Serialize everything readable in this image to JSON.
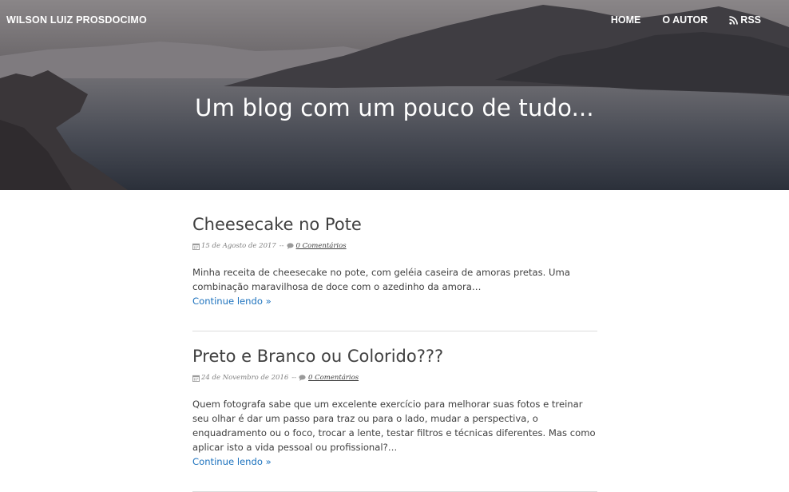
{
  "header": {
    "brand": "WILSON LUIZ PROSDOCIMO",
    "nav": [
      {
        "label": "HOME"
      },
      {
        "label": "O AUTOR"
      },
      {
        "label": "RSS",
        "icon": "rss-icon"
      }
    ],
    "tagline": "Um blog com um pouco de tudo..."
  },
  "posts": [
    {
      "title": "Cheesecake no Pote",
      "date": "15 de Agosto de 2017",
      "separator": "--",
      "comments": "0 Comentários",
      "excerpt": "Minha receita de cheesecake no pote, com geléia caseira de amoras pretas. Uma combinação maravilhosa de doce com o azedinho da amora…",
      "more": "Continue lendo »"
    },
    {
      "title": "Preto e Branco ou Colorido???",
      "date": "24 de Novembro de 2016",
      "separator": "--",
      "comments": "0 Comentários",
      "excerpt": "Quem fotografa sabe que um excelente exercício para melhorar suas fotos e treinar seu olhar é dar um passo para traz ou para o lado, mudar a perspectiva, o enquadramento ou o foco, trocar a lente, testar filtros e técnicas diferentes. Mas como aplicar isto a vida pessoal ou profissional?…",
      "more": "Continue lendo »"
    }
  ],
  "colors": {
    "link": "#1e73be",
    "text": "#404040",
    "meta": "#808080"
  }
}
